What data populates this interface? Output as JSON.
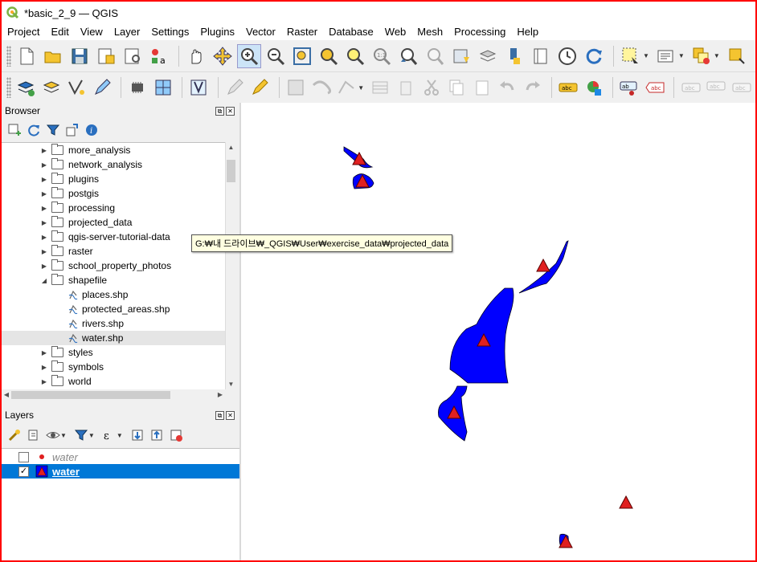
{
  "window": {
    "title": "*basic_2_9 — QGIS"
  },
  "menubar": [
    "Project",
    "Edit",
    "View",
    "Layer",
    "Settings",
    "Plugins",
    "Vector",
    "Raster",
    "Database",
    "Web",
    "Mesh",
    "Processing",
    "Help"
  ],
  "toolbar_icons": {
    "row1": [
      "new-project-icon",
      "open-project-icon",
      "save-project-icon",
      "save-as-icon",
      "print-layout-icon",
      "style-manager-icon",
      "pan-icon",
      "pan-to-selection-icon",
      "zoom-in-icon",
      "zoom-out-icon",
      "zoom-full-icon",
      "zoom-to-selection-icon",
      "zoom-to-layer-icon",
      "zoom-native-icon",
      "zoom-last-icon",
      "zoom-next-icon",
      "new-bookmark-icon",
      "show-bookmarks-icon",
      "new-map-view-icon",
      "temporal-controller-icon",
      "refresh-icon",
      "select-features-icon",
      "identify-icon",
      "deselect-icon",
      "annotation-icon"
    ],
    "row2": [
      "add-layer-icon",
      "data-source-manager-icon",
      "digitize-icon",
      "edit-pencil-icon",
      "toggle-editing-icon",
      "save-edits-icon",
      "add-feature-icon",
      "vertex-tool-icon",
      "delete-selected-icon",
      "cut-icon",
      "copy-icon",
      "paste-icon",
      "undo-icon",
      "redo-icon",
      "label-icon",
      "diagram-icon",
      "pin-label-icon",
      "show-hide-labels-icon"
    ]
  },
  "browser_panel": {
    "title": "Browser",
    "tree": [
      {
        "label": "more_analysis",
        "type": "folder",
        "expanded": false
      },
      {
        "label": "network_analysis",
        "type": "folder",
        "expanded": false
      },
      {
        "label": "plugins",
        "type": "folder",
        "expanded": false
      },
      {
        "label": "postgis",
        "type": "folder",
        "expanded": false
      },
      {
        "label": "processing",
        "type": "folder",
        "expanded": false
      },
      {
        "label": "projected_data",
        "type": "folder",
        "expanded": false
      },
      {
        "label": "qgis-server-tutorial-data",
        "type": "folder",
        "expanded": false
      },
      {
        "label": "raster",
        "type": "folder",
        "expanded": false
      },
      {
        "label": "school_property_photos",
        "type": "folder",
        "expanded": false
      },
      {
        "label": "shapefile",
        "type": "folder",
        "expanded": true
      },
      {
        "label": "places.shp",
        "type": "shp",
        "indent": true
      },
      {
        "label": "protected_areas.shp",
        "type": "shp",
        "indent": true
      },
      {
        "label": "rivers.shp",
        "type": "shp",
        "indent": true
      },
      {
        "label": "water.shp",
        "type": "shp",
        "indent": true,
        "selected": true
      },
      {
        "label": "styles",
        "type": "folder",
        "expanded": false
      },
      {
        "label": "symbols",
        "type": "folder",
        "expanded": false
      },
      {
        "label": "world",
        "type": "folder",
        "expanded": false
      }
    ],
    "tooltip": "G:₩내 드라이브₩_QGIS₩User₩exercise_data₩projected_data"
  },
  "layers_panel": {
    "title": "Layers",
    "layers": [
      {
        "name": "water",
        "checked": false,
        "symbol": "point-red",
        "style": "italic"
      },
      {
        "name": "water",
        "checked": true,
        "symbol": "polygon-blue",
        "style": "selected"
      }
    ]
  },
  "colors": {
    "water_fill": "#0000ff",
    "marker_fill": "#e02020",
    "selection": "#0078d7",
    "frame": "#ff0000"
  }
}
